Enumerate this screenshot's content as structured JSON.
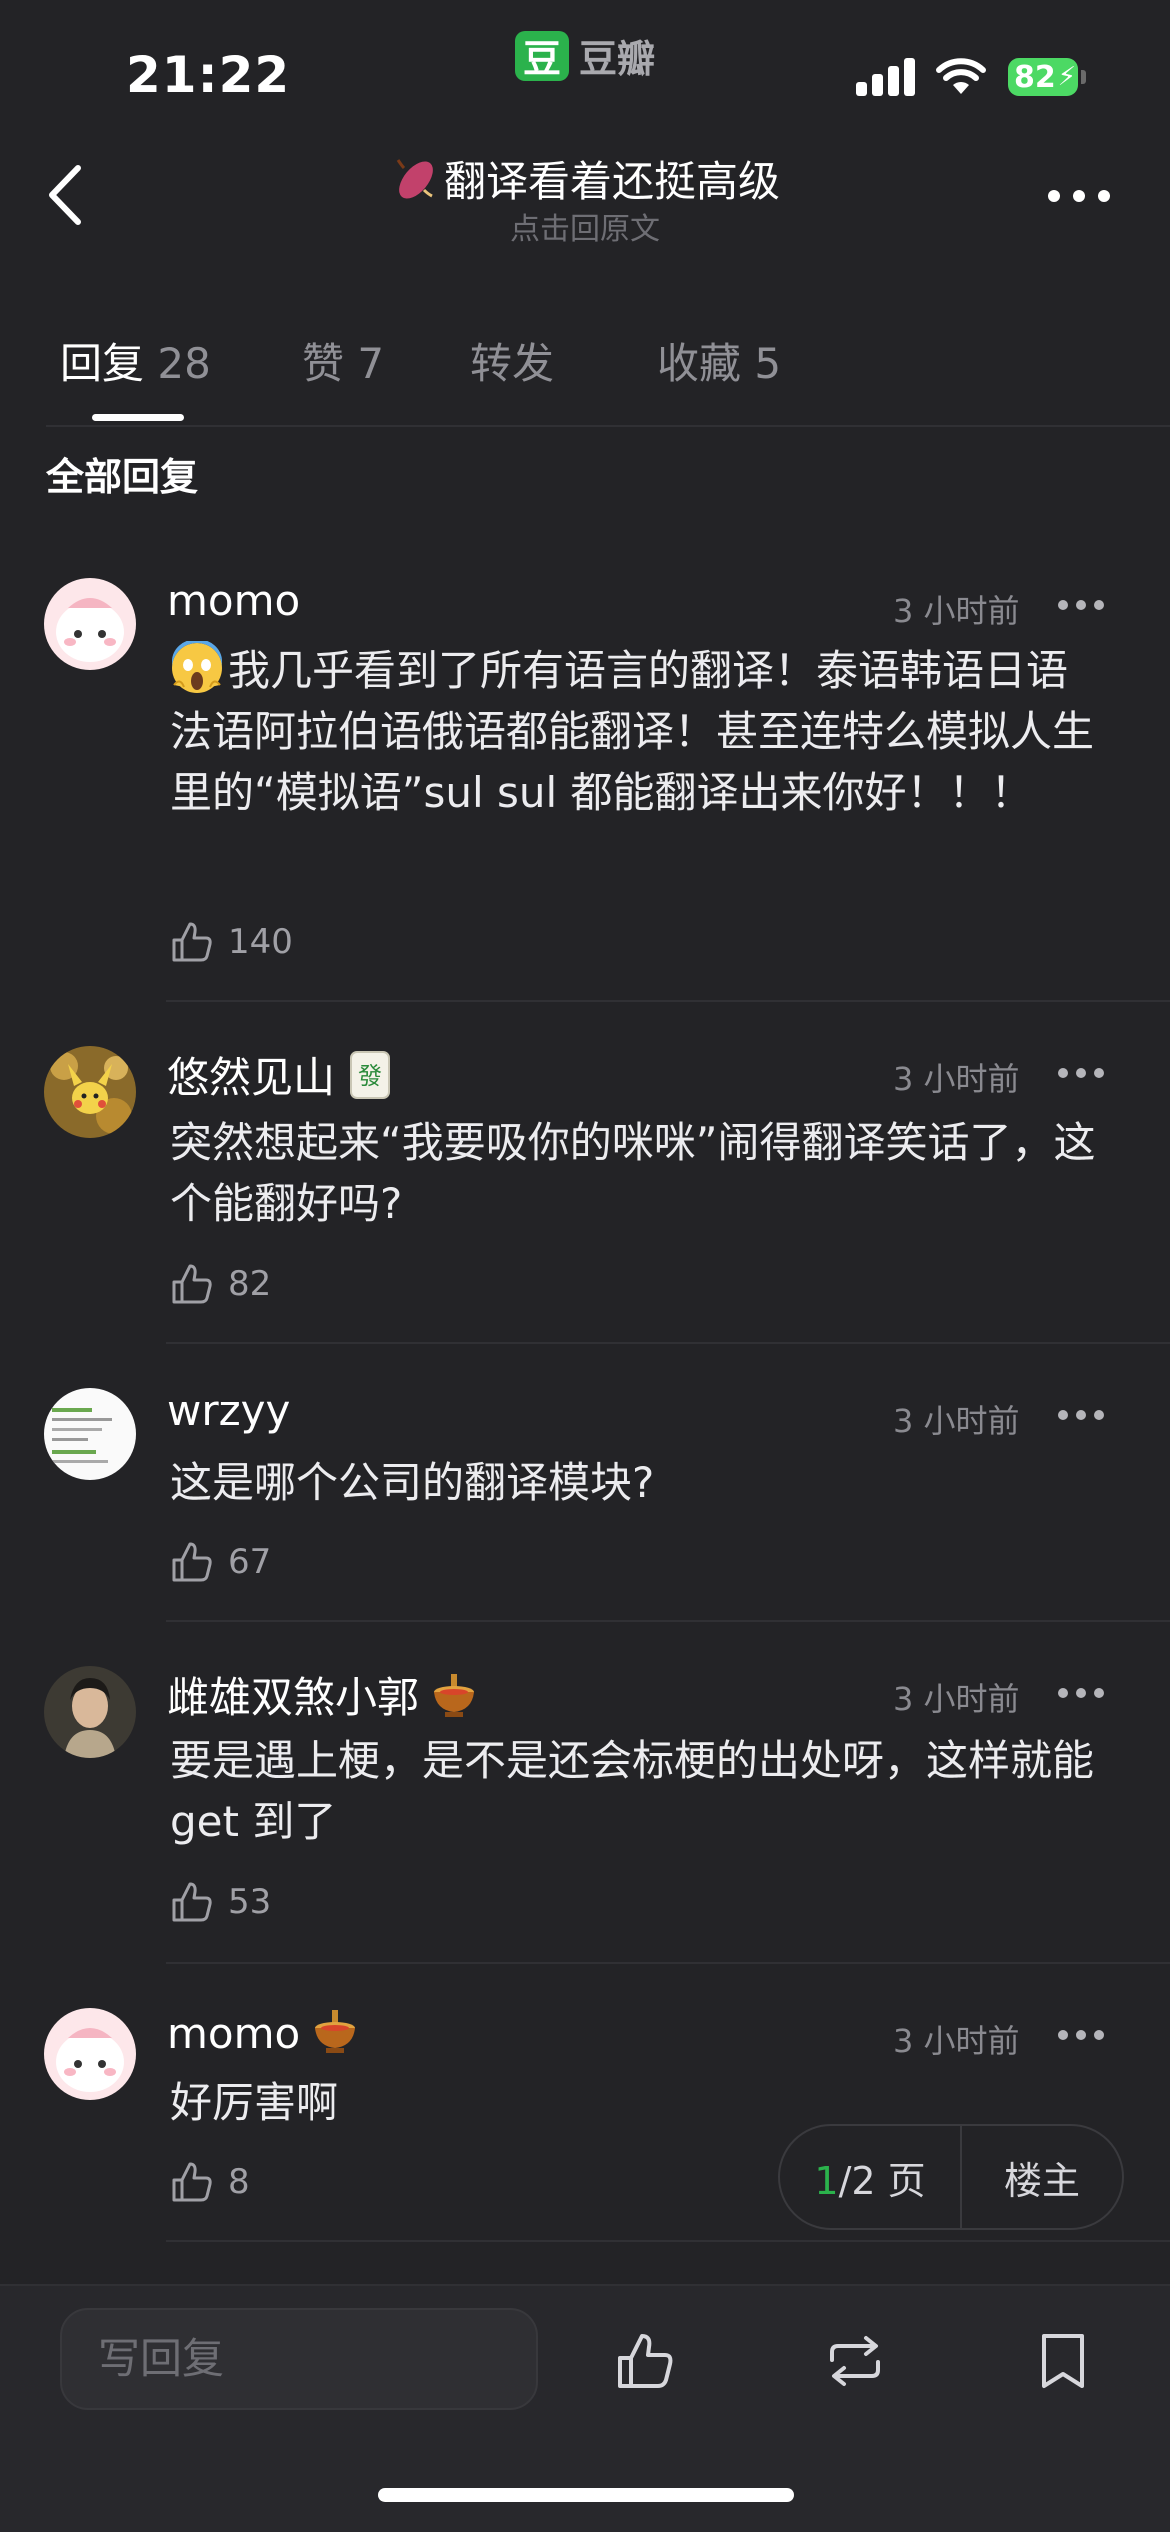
{
  "status_bar": {
    "time": "21:22",
    "app_name": "豆瓣",
    "app_logo": "豆",
    "battery": "82"
  },
  "nav": {
    "title": "翻译看着还挺高级",
    "subtitle": "点击回原文",
    "title_emoji": "sweet-potato"
  },
  "tabs": [
    {
      "label": "回复",
      "count": "28"
    },
    {
      "label": "赞",
      "count": "7"
    },
    {
      "label": "转发",
      "count": ""
    },
    {
      "label": "收藏",
      "count": "5"
    }
  ],
  "section_title": "全部回复",
  "comments": [
    {
      "user": "momo",
      "time": "3 小时前",
      "text": "我几乎看到了所有语言的翻译！泰语韩语日语法语阿拉伯语俄语都能翻译！甚至连特么模拟人生里的“模拟语”sul sul 都能翻译出来你好！！！",
      "likes": "140",
      "leading_emoji": "screaming-face",
      "badge": ""
    },
    {
      "user": "悠然见山",
      "time": "3 小时前",
      "text": "突然想起来“我要吸你的咪咪”闹得翻译笑话了，这个能翻好吗?",
      "likes": "82",
      "badge": "mahjong-tile"
    },
    {
      "user": "wrzyy",
      "time": "3 小时前",
      "text": "这是哪个公司的翻译模块?",
      "likes": "67",
      "badge": ""
    },
    {
      "user": "雌雄双煞小郭",
      "time": "3 小时前",
      "text": "要是遇上梗，是不是还会标梗的出处呀，这样就能 get 到了",
      "likes": "53",
      "badge": "hotpot"
    },
    {
      "user": "momo",
      "time": "3 小时前",
      "text": "好厉害啊",
      "likes": "8",
      "badge": "hotpot"
    }
  ],
  "pager": {
    "current": "1",
    "total": "/2 页",
    "owner": "楼主"
  },
  "bottom_bar": {
    "reply_placeholder": "写回复"
  },
  "colors": {
    "accent": "#2bb24c",
    "background": "#232326"
  }
}
